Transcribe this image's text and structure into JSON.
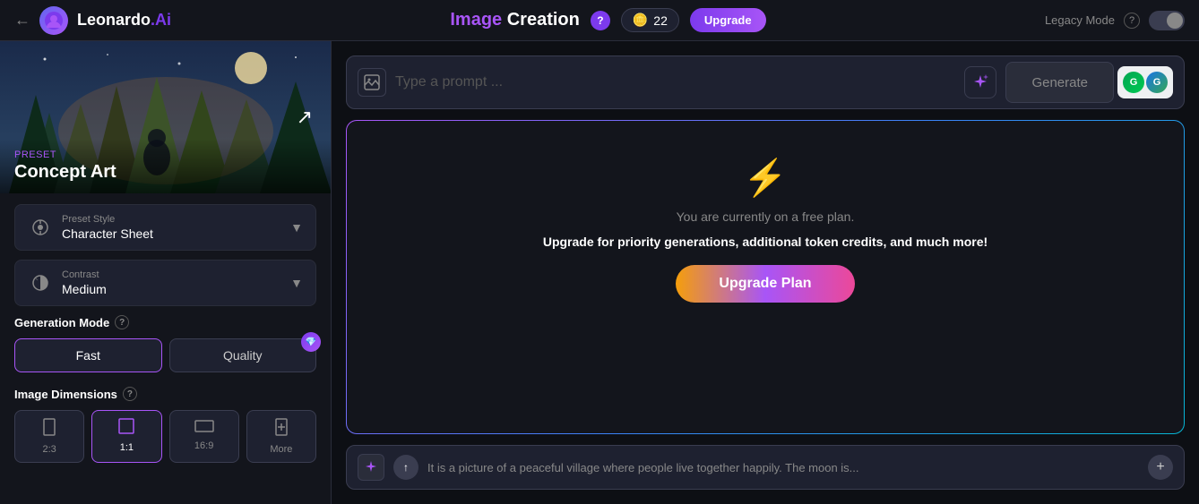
{
  "brand": {
    "back_arrow": "←",
    "logo_alt": "Leonardo",
    "name_leo": "Leonardo",
    "name_ai": ".Ai"
  },
  "header": {
    "title_img": "Image",
    "title_creation": " Creation",
    "help_label": "?",
    "token_icon": "🪙",
    "token_count": "22",
    "upgrade_label": "Upgrade",
    "legacy_mode_label": "Legacy Mode",
    "help_small": "?",
    "grammarly1": "G",
    "grammarly2": "G"
  },
  "sidebar": {
    "preset_label": "Preset",
    "preset_name": "Concept Art",
    "preset_style_label": "Preset Style",
    "preset_style_value": "Character Sheet",
    "contrast_label": "Contrast",
    "contrast_value": "Medium",
    "generation_mode_label": "Generation Mode",
    "mode_fast": "Fast",
    "mode_quality": "Quality",
    "image_dimensions_label": "Image Dimensions",
    "dim_23": "2:3",
    "dim_11": "1:1",
    "dim_169": "16:9",
    "dim_more": "More"
  },
  "prompt": {
    "placeholder": "Type a prompt ...",
    "generate_label": "Generate"
  },
  "upgrade_card": {
    "lightning": "⚡",
    "free_plan_text": "You are currently on a free plan.",
    "upgrade_benefits": "Upgrade for priority generations, additional token credits, and much more!",
    "upgrade_btn_label": "Upgrade Plan"
  },
  "history": {
    "magic_icon": "✨",
    "up_icon": "↑",
    "text": "It is a picture of a peaceful village where people live together happily. The moon is...",
    "add_icon": "+"
  }
}
